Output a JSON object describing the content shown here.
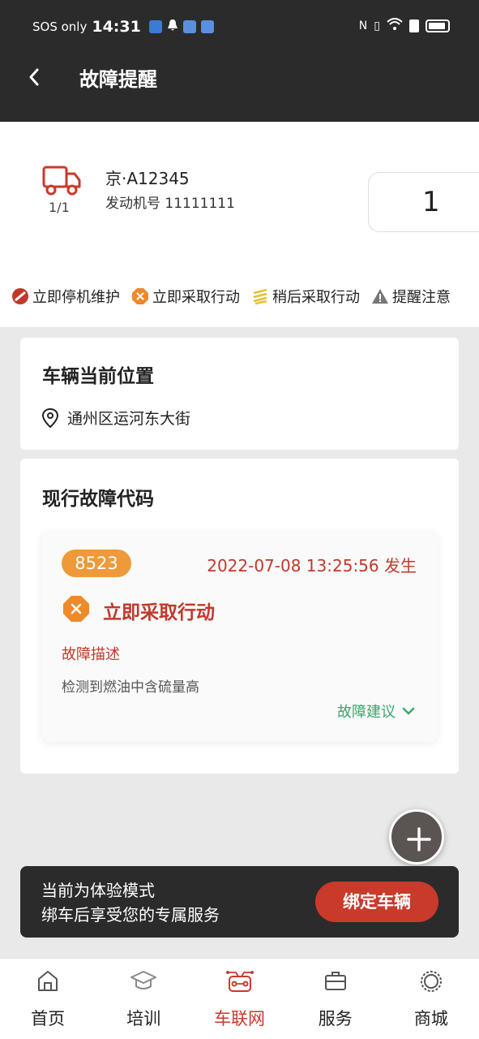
{
  "status_bar": {
    "carrier": "SOS only",
    "time": "14:31"
  },
  "header": {
    "title": "故障提醒",
    "back_icon": "chevron-left-icon"
  },
  "vehicle": {
    "icon": "truck-icon",
    "count": "1/1",
    "plate": "京·A12345",
    "engine": "发动机号 11111111",
    "number": "1"
  },
  "legend": [
    {
      "label": "立即停机维护",
      "icon": "stop-icon",
      "color": "#c0392b"
    },
    {
      "label": "立即采取行动",
      "icon": "octagon-x-icon",
      "color": "#ee8a2a"
    },
    {
      "label": "稍后采取行动",
      "icon": "stripes-icon",
      "color": "#e8c12a"
    },
    {
      "label": "提醒注意",
      "icon": "warning-triangle-icon",
      "color": "#777777"
    }
  ],
  "location": {
    "title": "车辆当前位置",
    "address": "通州区运河东大街"
  },
  "fault": {
    "title": "现行故障代码",
    "code": "8523",
    "occurred": "2022-07-08 13:25:56 发生",
    "action_label": "立即采取行动",
    "desc_label": "故障描述",
    "desc_text": "检测到燃油中含硫量高",
    "advice_label": "故障建议"
  },
  "banner": {
    "line1": "当前为体验模式",
    "line2": "绑车后享受您的专属服务",
    "button": "绑定车辆"
  },
  "nav": [
    {
      "label": "首页",
      "icon": "home-icon"
    },
    {
      "label": "培训",
      "icon": "graduation-cap-icon"
    },
    {
      "label": "车联网",
      "icon": "connected-car-icon",
      "active": true
    },
    {
      "label": "服务",
      "icon": "briefcase-icon"
    },
    {
      "label": "商城",
      "icon": "gear-icon"
    }
  ],
  "colors": {
    "accent": "#c93a2b",
    "header_bg": "#2b2b2b",
    "badge": "#ee9a3a",
    "advice": "#3aa76d"
  }
}
